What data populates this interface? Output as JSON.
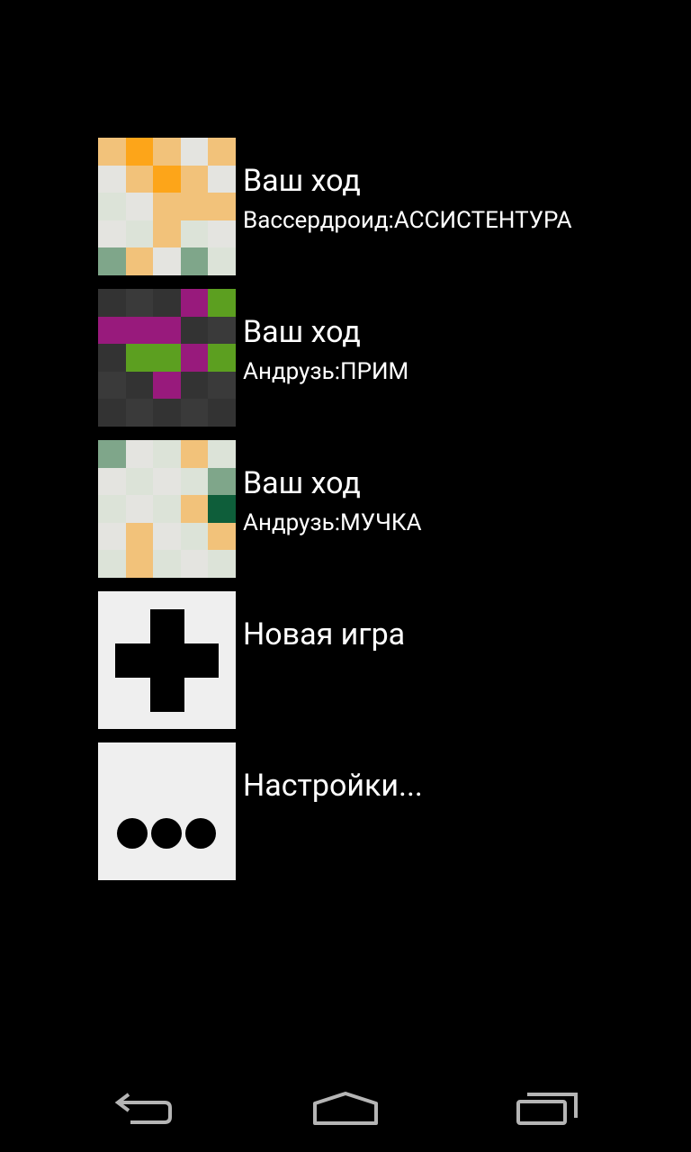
{
  "games": [
    {
      "title": "Ваш ход",
      "subtitle": "Вассердроид:АССИСТЕНТУРА",
      "board": [
        [
          "#f2c27a",
          "#fda519",
          "#f2c27a",
          "#e4e4e0",
          "#f2c27a"
        ],
        [
          "#e4e4e0",
          "#f2c27a",
          "#fda519",
          "#f2c27a",
          "#e4e4e0"
        ],
        [
          "#dce3d8",
          "#e4e4e0",
          "#f2c27a",
          "#f2c27a",
          "#f2c27a"
        ],
        [
          "#e4e4e0",
          "#dce3d8",
          "#f2c27a",
          "#dce3d8",
          "#e4e4e0"
        ],
        [
          "#7fa68a",
          "#f2c27a",
          "#e4e4e0",
          "#7fa68a",
          "#dce3d8"
        ]
      ]
    },
    {
      "title": "Ваш ход",
      "subtitle": "Андрузь:ПРИМ",
      "board": [
        [
          "#333333",
          "#3a3a3a",
          "#333333",
          "#981a7c",
          "#5c9f20"
        ],
        [
          "#981a7c",
          "#981a7c",
          "#981a7c",
          "#333333",
          "#3a3a3a"
        ],
        [
          "#333333",
          "#5c9f20",
          "#5c9f20",
          "#981a7c",
          "#5c9f20"
        ],
        [
          "#3a3a3a",
          "#333333",
          "#981a7c",
          "#333333",
          "#3a3a3a"
        ],
        [
          "#333333",
          "#3a3a3a",
          "#333333",
          "#3a3a3a",
          "#333333"
        ]
      ]
    },
    {
      "title": "Ваш ход",
      "subtitle": "Андрузь:МУЧКА",
      "board": [
        [
          "#7fa68a",
          "#e4e4e0",
          "#dce3d8",
          "#f2c27a",
          "#dce3d8"
        ],
        [
          "#e4e4e0",
          "#dce3d8",
          "#e4e4e0",
          "#dce3d8",
          "#7fa68a"
        ],
        [
          "#dce3d8",
          "#e4e4e0",
          "#dce3d8",
          "#f2c27a",
          "#0e5e3a"
        ],
        [
          "#e4e4e0",
          "#f2c27a",
          "#e4e4e0",
          "#dce3d8",
          "#f2c27a"
        ],
        [
          "#dce3d8",
          "#f2c27a",
          "#dce3d8",
          "#e4e4e0",
          "#dce3d8"
        ]
      ]
    }
  ],
  "new_game": {
    "label": "Новая игра",
    "icon": "plus-icon"
  },
  "settings": {
    "label": "Настройки...",
    "icon": "more-dots-icon"
  },
  "navbar": {
    "back_icon": "back-icon",
    "home_icon": "home-icon",
    "recents_icon": "recents-icon"
  },
  "colors": {
    "background": "#000000",
    "tile_light": "#efefef",
    "text": "#ffffff"
  }
}
